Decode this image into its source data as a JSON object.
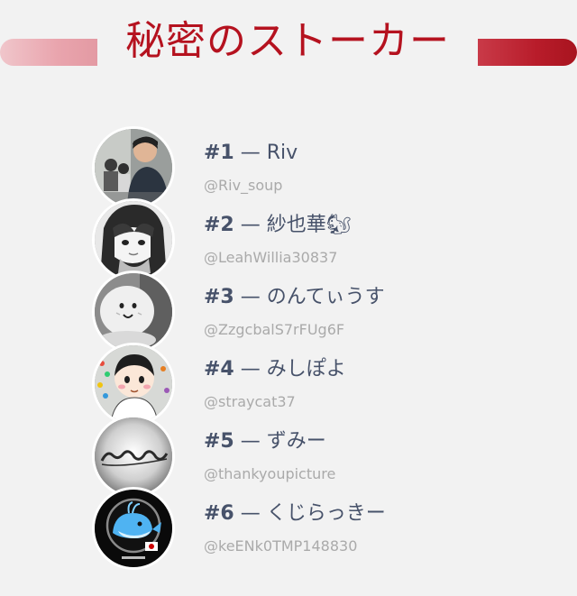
{
  "title": "秘密のストーカー",
  "separator": "—",
  "entries": [
    {
      "rank": "#1",
      "name": "Riv",
      "handle": "@Riv_soup",
      "avatar_icon": "person-photo-icon"
    },
    {
      "rank": "#2",
      "name": "紗也華🐿",
      "handle": "@LeahWillia30837",
      "avatar_icon": "anime-girl-icon"
    },
    {
      "rank": "#3",
      "name": "のんてぃうす",
      "handle": "@ZzgcbalS7rFUg6F",
      "avatar_icon": "mochi-face-icon"
    },
    {
      "rank": "#4",
      "name": "みしぽよ",
      "handle": "@straycat37",
      "avatar_icon": "chibi-boy-icon"
    },
    {
      "rank": "#5",
      "name": "ずみー",
      "handle": "@thankyoupicture",
      "avatar_icon": "stressless-logo-icon"
    },
    {
      "rank": "#6",
      "name": "くじらっきー",
      "handle": "@keENk0TMP148830",
      "avatar_icon": "whale-icon"
    }
  ],
  "colors": {
    "background": "#f2f2f2",
    "title": "#b5121f",
    "name": "#47526a",
    "handle": "#aaaaaa"
  }
}
